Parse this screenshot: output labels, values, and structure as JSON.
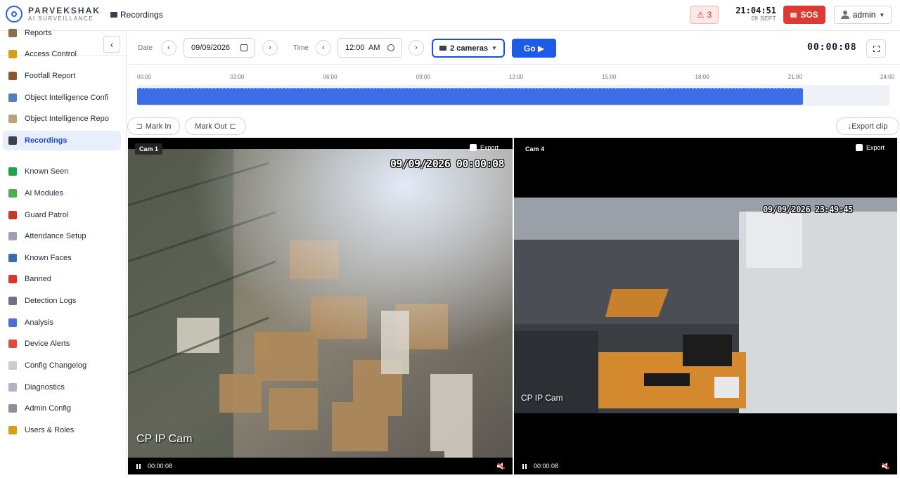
{
  "brand": {
    "name": "PARVEKSHAK",
    "tagline": "AI SURVEILLANCE"
  },
  "header": {
    "page_title": "Recordings",
    "page_icon": "recordings-icon",
    "alert_count": "3",
    "alert_icon": "warning-icon",
    "clock_time": "21:04:51",
    "clock_date": "09 SEPT",
    "sos_label": "SOS",
    "user_label": "admin"
  },
  "sidebar": {
    "collapse_icon": "chevron-left-icon",
    "items": [
      {
        "label": "Reports",
        "icon": "chart-icon",
        "color": "#8b6f4e"
      },
      {
        "label": "Access Control",
        "icon": "key-icon",
        "color": "#d4a017"
      },
      {
        "label": "Footfall Report",
        "icon": "walking-icon",
        "color": "#8b5a2b"
      },
      {
        "label": "Object Intelligence Confi",
        "icon": "grid-icon",
        "color": "#5b7db5"
      },
      {
        "label": "Object Intelligence Repo",
        "icon": "document-icon",
        "color": "#b8a27a"
      },
      {
        "label": "Recordings",
        "icon": "recordings-icon",
        "color": "#374151"
      },
      {
        "label": "Known Seen",
        "icon": "checkmark-icon",
        "color": "#22a14a"
      },
      {
        "label": "AI Modules",
        "icon": "puzzle-icon",
        "color": "#4caf50"
      },
      {
        "label": "Guard Patrol",
        "icon": "shield-icon",
        "color": "#c0392b"
      },
      {
        "label": "Attendance Setup",
        "icon": "clock-icon",
        "color": "#9ca3af"
      },
      {
        "label": "Known Faces",
        "icon": "person-icon",
        "color": "#3b6ea8"
      },
      {
        "label": "Banned",
        "icon": "prohibited-icon",
        "color": "#d9362b"
      },
      {
        "label": "Detection Logs",
        "icon": "magnifier-icon",
        "color": "#6b7280"
      },
      {
        "label": "Analysis",
        "icon": "bar-chart-icon",
        "color": "#4a6fd1"
      },
      {
        "label": "Device Alerts",
        "icon": "alarm-icon",
        "color": "#e04a3b"
      },
      {
        "label": "Config Changelog",
        "icon": "page-icon",
        "color": "#c8ccd2"
      },
      {
        "label": "Diagnostics",
        "icon": "stethoscope-icon",
        "color": "#b0b6c0"
      },
      {
        "label": "Admin Config",
        "icon": "gear-icon",
        "color": "#8a8f98"
      },
      {
        "label": "Users & Roles",
        "icon": "lock-icon",
        "color": "#d4a017"
      }
    ],
    "active_index": 5
  },
  "controls": {
    "date_label": "Date",
    "date_value": "09/09/2026",
    "time_label": "Time",
    "time_value": "12:00  AM",
    "cameras_label": "2 cameras",
    "go_label": "Go ▶",
    "playback_timer": "00:00:08"
  },
  "timeline": {
    "ticks": [
      "00:00",
      "03:00",
      "06:00",
      "09:00",
      "12:00",
      "15:00",
      "18:00",
      "21:00",
      "24:00"
    ],
    "recorded_fraction": 0.885
  },
  "clip": {
    "mark_in": "Mark In",
    "mark_out": "Mark Out",
    "export_clip": "↓Export clip"
  },
  "cameras": [
    {
      "label": "Cam 1",
      "export_label": "Export",
      "osd_time": "09/09/2026 00:00:08",
      "osd_name": "CP IP Cam",
      "play_time": "00:00:08"
    },
    {
      "label": "Cam 4",
      "export_label": "Export",
      "osd_time": "09/09/2026 23:49:45",
      "osd_name": "CP IP Cam",
      "play_time": "00:00:08"
    }
  ]
}
